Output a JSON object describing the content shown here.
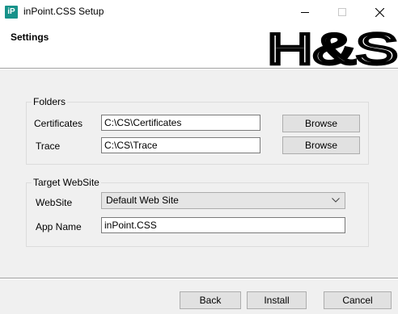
{
  "window": {
    "icon_text": "iP",
    "title": "inPoint.CSS Setup"
  },
  "header": {
    "title": "Settings",
    "logo_text": "H&S"
  },
  "folders": {
    "legend": "Folders",
    "certificates_label": "Certificates",
    "certificates_value": "C:\\CS\\Certificates",
    "trace_label": "Trace",
    "trace_value": "C:\\CS\\Trace",
    "browse_label": "Browse"
  },
  "target": {
    "legend": "Target WebSite",
    "website_label": "WebSite",
    "website_value": "Default Web Site",
    "appname_label": "App Name",
    "appname_value": "inPoint.CSS"
  },
  "footer": {
    "back_label": "Back",
    "install_label": "Install",
    "cancel_label": "Cancel"
  },
  "colors": {
    "icon_accent": "#17928a",
    "dialog_bg": "#f0f0f0"
  }
}
